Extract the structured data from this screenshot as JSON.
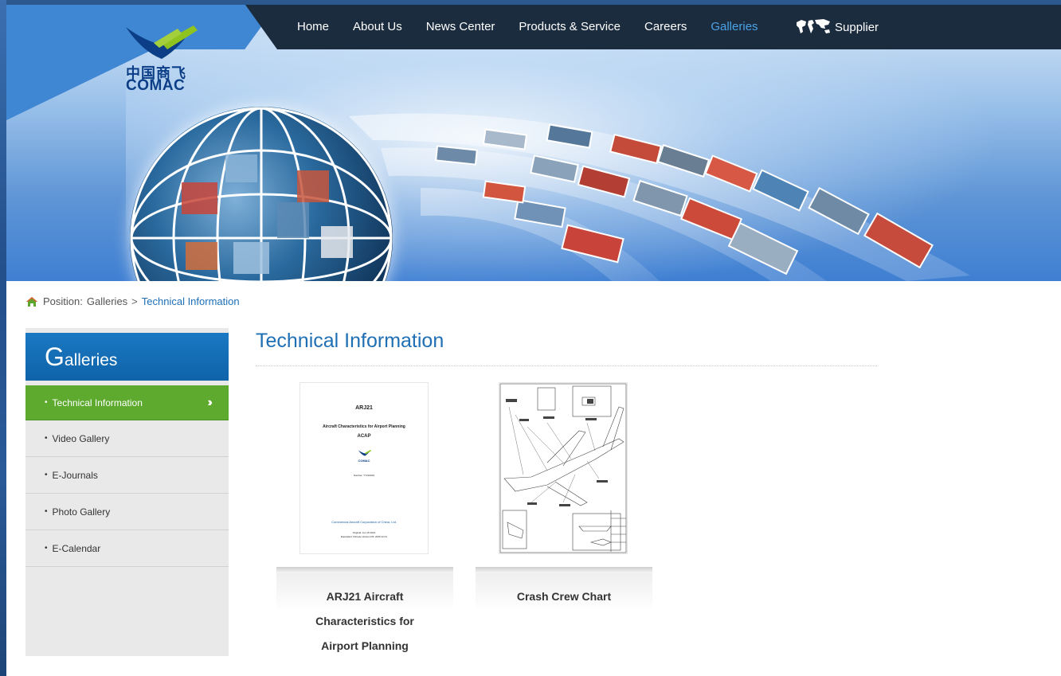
{
  "brand": {
    "logo_cn": "中国商飞",
    "logo_en": "COMAC",
    "colors": {
      "primary_blue": "#1a78c2",
      "nav_dark": "#1b2c3f",
      "active_green": "#5daa2e",
      "link_blue": "#1d6fb8"
    }
  },
  "nav": {
    "items": [
      {
        "label": "Home",
        "active": false
      },
      {
        "label": "About Us",
        "active": false
      },
      {
        "label": "News Center",
        "active": false
      },
      {
        "label": "Products & Service",
        "active": false
      },
      {
        "label": "Careers",
        "active": false
      },
      {
        "label": "Galleries",
        "active": true
      }
    ],
    "supplier_label": "Supplier",
    "supplier_icon": "world-map-icon"
  },
  "breadcrumb": {
    "icon": "home-icon",
    "prefix": "Position:",
    "parent": "Galleries",
    "separator": ">",
    "current": "Technical Information"
  },
  "sidebar": {
    "title_initial": "G",
    "title_rest": "alleries",
    "items": [
      {
        "label": "Technical Information",
        "active": true
      },
      {
        "label": "Video Gallery",
        "active": false
      },
      {
        "label": "E-Journals",
        "active": false
      },
      {
        "label": "Photo Gallery",
        "active": false
      },
      {
        "label": "E-Calendar",
        "active": false
      }
    ],
    "bullet": "•",
    "active_icon": "double-chevron-right-icon"
  },
  "main": {
    "title": "Technical Information",
    "cards": [
      {
        "caption_lines": [
          "ARJ21 Aircraft",
          "Characteristics for",
          "Airport Planning"
        ],
        "doc": {
          "heading": "ARJ21",
          "subtitle": "Aircraft Characteristics for Airport Planning",
          "abbr": "ACAP",
          "brand": "COMAC",
          "number": "Number: YY210001",
          "company": "Commercial Aircraft Corporation of China, Ltd.",
          "original": "Original: Jun 15 2016",
          "equivalent": "Equivalent Chinese Version R3: 2020.12.01"
        }
      },
      {
        "caption_lines": [
          "Crash Crew Chart"
        ]
      }
    ]
  }
}
